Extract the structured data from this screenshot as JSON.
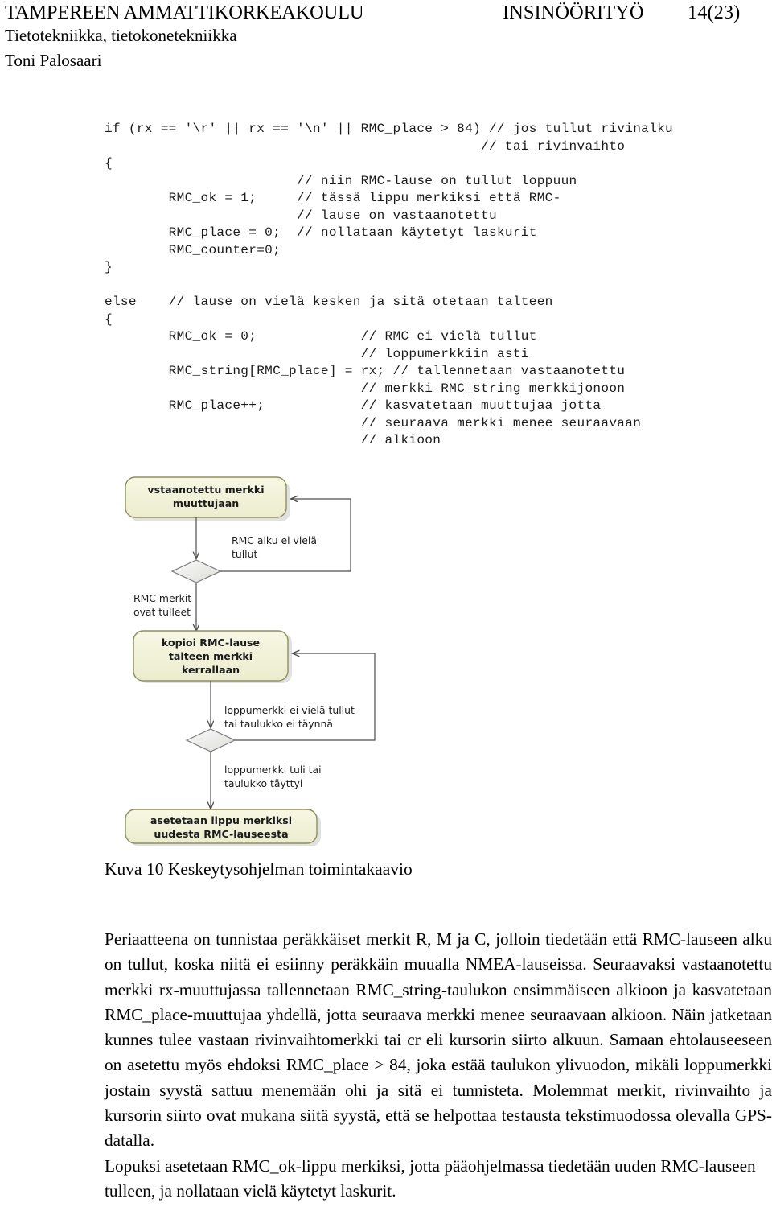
{
  "header": {
    "school": "TAMPEREEN AMMATTIKORKEAKOULU",
    "doc_type": "INSINÖÖRITYÖ",
    "page_number": "14(23)",
    "department": "Tietotekniikka, tietokonetekniikka",
    "author": "Toni Palosaari"
  },
  "code_block": {
    "language": "c",
    "text": "if (rx == '\\r' || rx == '\\n' || RMC_place > 84) // jos tullut rivinalku\n                                               // tai rivinvaihto\n{\n                        // niin RMC-lause on tullut loppuun\n        RMC_ok = 1;     // tässä lippu merkiksi että RMC-\n                        // lause on vastaanotettu\n        RMC_place = 0;  // nollataan käytetyt laskurit\n        RMC_counter=0;\n}\n\nelse    // lause on vielä kesken ja sitä otetaan talteen\n{\n        RMC_ok = 0;             // RMC ei vielä tullut\n                                // loppumerkkiin asti\n        RMC_string[RMC_place] = rx; // tallennetaan vastaanotettu\n                                // merkki RMC_string merkkijonoon\n        RMC_place++;            // kasvatetaan muuttujaa jotta\n                                // seuraava merkki menee seuraavaan\n                                // alkioon"
  },
  "flowchart": {
    "type": "activity-diagram",
    "node_fill": "#f2f2d9",
    "node_border": "#8f8f5c",
    "decision_fill": "#eaeae6",
    "decision_border": "#7a7a7a",
    "line_color": "#4d4d4d",
    "nodes": [
      {
        "id": "n1",
        "shape": "rounded-rect",
        "lines": [
          "vstaanotettu merkki",
          "muuttujaan"
        ]
      },
      {
        "id": "d1",
        "shape": "diamond",
        "lines": []
      },
      {
        "id": "n2",
        "shape": "rounded-rect",
        "lines": [
          "kopioi RMC-lause",
          "talteen merkki",
          "kerrallaan"
        ]
      },
      {
        "id": "d2",
        "shape": "diamond",
        "lines": []
      },
      {
        "id": "n3",
        "shape": "rounded-rect",
        "lines": [
          "asetetaan lippu merkiksi",
          "uudesta RMC-lauseesta"
        ]
      }
    ],
    "edge_labels": [
      {
        "id": "e1",
        "lines": [
          "RMC alku ei vielä",
          "tullut"
        ]
      },
      {
        "id": "e2",
        "lines": [
          "RMC merkit",
          "ovat tulleet"
        ]
      },
      {
        "id": "e3",
        "lines": [
          "loppumerkki ei vielä tullut",
          "tai taulukko ei täynnä"
        ]
      },
      {
        "id": "e4",
        "lines": [
          "loppumerkki tuli tai",
          "taulukko täyttyi"
        ]
      }
    ]
  },
  "figure_caption": "Kuva 10 Keskeytysohjelman toimintakaavio",
  "body_paragraph": {
    "part1": "Periaatteena on tunnistaa peräkkäiset merkit R, M ja C, jolloin tiedetään että RMC-lauseen alku on tullut, koska niitä ei esiinny peräkkäin muualla NMEA-lauseissa. Seuraavaksi vastaanotettu merkki rx-muuttujassa tallennetaan RMC_string-taulukon ensimmäiseen alkioon ja kasvatetaan RMC_place-muuttujaa yhdellä, jotta seuraava merkki menee seuraavaan alkioon. Näin jatketaan kunnes tulee vastaan rivinvaihtomerkki tai cr eli kursorin siirto alkuun. Samaan ehtolauseeseen on asetettu myös ehdoksi RMC_place > 84, joka estää taulukon ylivuodon, mikäli loppumerkki jostain syystä sattuu menemään ohi ja sitä ei tunnisteta. Molemmat merkit, rivinvaihto ja kursorin siirto ovat mukana siitä syystä, että se helpottaa testausta tekstimuodossa olevalla GPS-datalla.",
    "part2": "Lopuksi asetetaan RMC_ok-lippu merkiksi, jotta pääohjelmassa tiedetään uuden RMC-lauseen tulleen, ja nollataan vielä käytetyt laskurit."
  }
}
